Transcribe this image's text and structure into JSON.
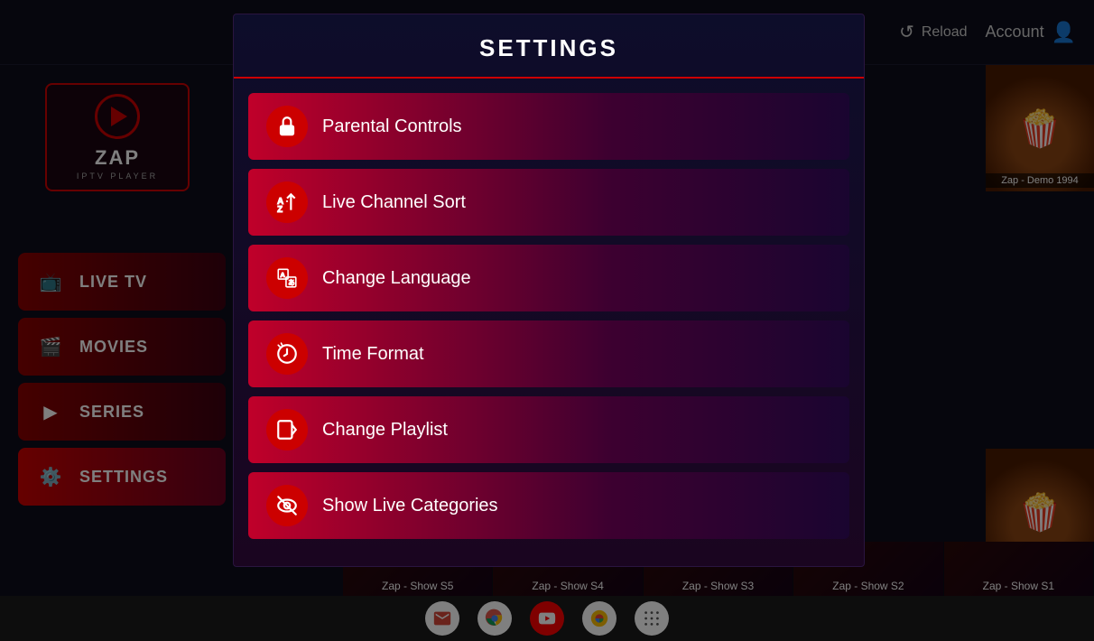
{
  "app": {
    "title": "ZAP IPTV Player",
    "logo_text": "ZAP",
    "logo_sub": "IPTV PLAYER"
  },
  "header": {
    "reload_label": "Reload",
    "account_label": "Account"
  },
  "sidebar": {
    "items": [
      {
        "id": "live-tv",
        "label": "LIVE TV",
        "icon": "tv"
      },
      {
        "id": "movies",
        "label": "MOVIES",
        "icon": "movies"
      },
      {
        "id": "series",
        "label": "SERIES",
        "icon": "series"
      },
      {
        "id": "settings",
        "label": "SETTINGS",
        "icon": "settings",
        "active": true
      }
    ]
  },
  "settings": {
    "title": "SETTINGS",
    "items": [
      {
        "id": "parental",
        "label": "Parental Controls",
        "icon": "lock"
      },
      {
        "id": "sort",
        "label": "Live Channel Sort",
        "icon": "sort"
      },
      {
        "id": "language",
        "label": "Change Language",
        "icon": "language"
      },
      {
        "id": "time",
        "label": "Time Format",
        "icon": "time"
      },
      {
        "id": "playlist",
        "label": "Change Playlist",
        "icon": "playlist"
      },
      {
        "id": "categories",
        "label": "Show Live Categories",
        "icon": "eye-off"
      }
    ]
  },
  "bottom_strip": {
    "items": [
      {
        "label": "Zap - Show S5"
      },
      {
        "label": "Zap - Show S4"
      },
      {
        "label": "Zap - Show S3"
      },
      {
        "label": "Zap - Show S2"
      },
      {
        "label": "Zap - Show S1"
      }
    ]
  },
  "thumbnails": [
    {
      "label": "Zap - Demo 1994"
    }
  ],
  "taskbar": {
    "icons": [
      {
        "id": "gmail",
        "label": "M",
        "color": "#fff",
        "bg": "#fff"
      },
      {
        "id": "chrome",
        "label": "⬤",
        "color": "#4285F4",
        "bg": "#fff"
      },
      {
        "id": "youtube",
        "label": "▶",
        "color": "#fff",
        "bg": "#ff0000"
      },
      {
        "id": "photos",
        "label": "✿",
        "color": "#fbbc04",
        "bg": "#fff"
      },
      {
        "id": "apps",
        "label": "⠿",
        "color": "#555",
        "bg": "#fff"
      }
    ]
  }
}
